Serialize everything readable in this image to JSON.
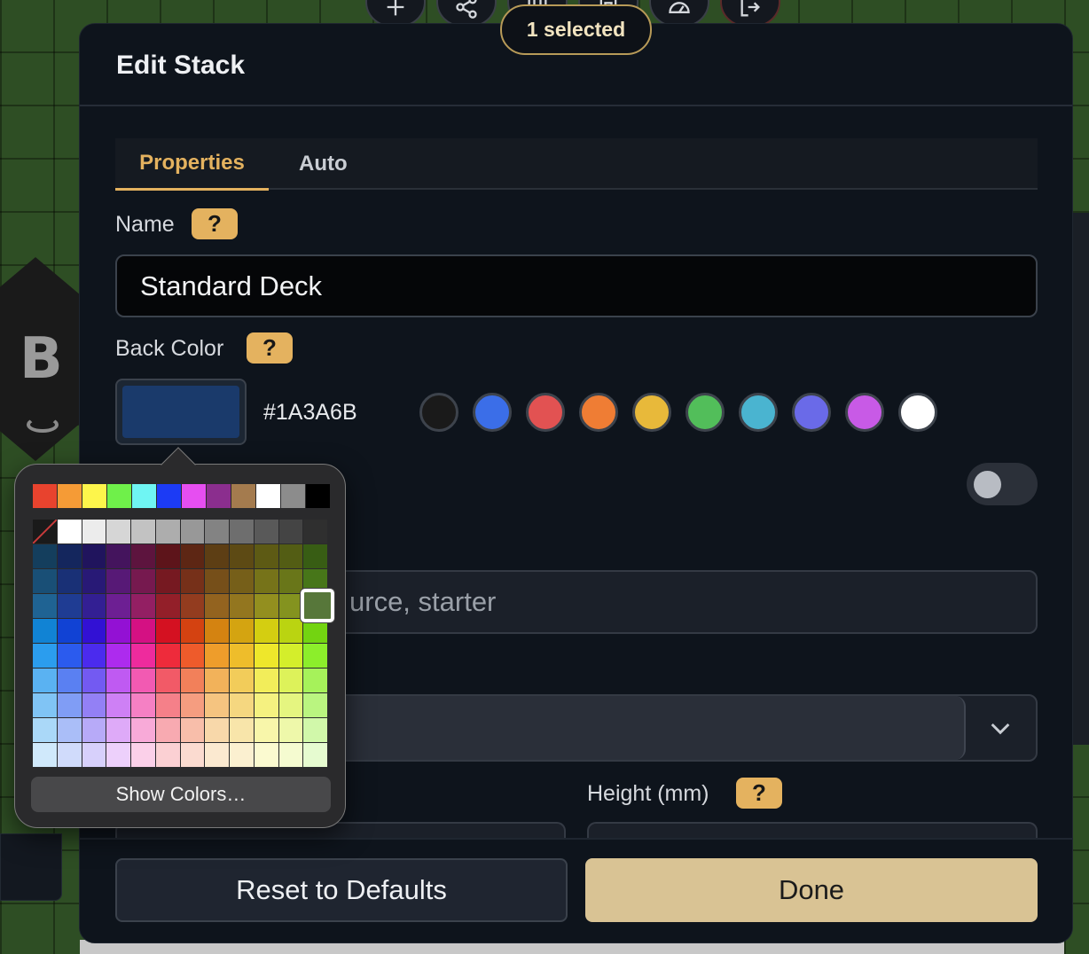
{
  "toolbar": {
    "selected_label": "1 selected",
    "buttons": [
      {
        "icon": "plus-icon"
      },
      {
        "icon": "share-icon"
      },
      {
        "icon": "grid-icon"
      },
      {
        "icon": "layout-icon"
      },
      {
        "icon": "gauge-icon"
      },
      {
        "icon": "exit-icon"
      }
    ]
  },
  "background": {
    "die_letter": "B"
  },
  "dialog": {
    "title": "Edit Stack",
    "tabs": [
      {
        "label": "Properties",
        "active": true
      },
      {
        "label": "Auto",
        "active": false
      }
    ],
    "name_field": {
      "label": "Name",
      "help": "?",
      "value": "Standard Deck"
    },
    "back_color": {
      "label": "Back Color",
      "help": "?",
      "current_color": "#1A3A6B",
      "hex_text": "#1A3A6B",
      "presets": [
        "#1a1a1a",
        "#3b6ee8",
        "#e25252",
        "#ef7d34",
        "#e8b93a",
        "#52be5a",
        "#4ab4d0",
        "#6a6ae8",
        "#c85ae6",
        "#ffffff"
      ]
    },
    "toggle": {
      "on": false
    },
    "tags_field": {
      "placeholder_visible": "urce, starter"
    },
    "height_field": {
      "label": "Height (mm)",
      "help": "?"
    },
    "reset_button": "Reset to Defaults",
    "done_button": "Done"
  },
  "color_picker": {
    "show_colors_label": "Show Colors…",
    "selected_color": "#57773a",
    "top_row": [
      "#e8432e",
      "#f59b36",
      "#fdf54b",
      "#6ff04a",
      "#6ff5f3",
      "#1c3bf5",
      "#e64ef1",
      "#8b2e8e",
      "#a47b4e",
      "#ffffff",
      "#8c8c8c",
      "#000000"
    ]
  }
}
